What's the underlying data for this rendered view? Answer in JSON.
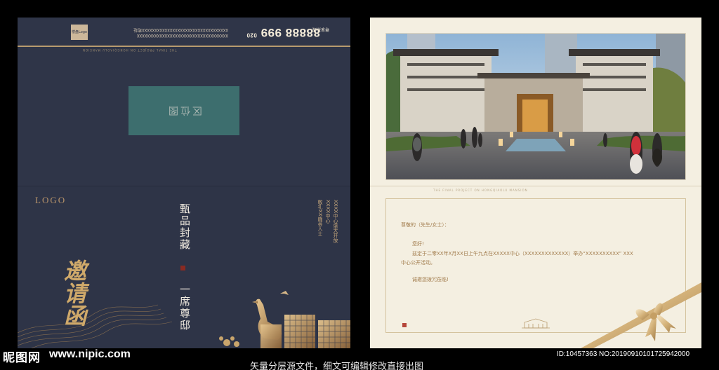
{
  "left_card": {
    "top_logo": "楼盘Logo",
    "top_xx_line1": "XXXXXXXXXXXXXXXXXXXXXXXXXXXXXXXXXXXX",
    "top_xx_line2": "XXXXXXXXXXXXXXXXXXXXXXXXXXXXXXXXXX地址",
    "phone": "88888 999",
    "phone_prefix": "020",
    "hotline_label": "尊享热线",
    "tagline": "THE FINAL PROJECT ON HONGQIAOLU MANSION",
    "placeholder": "区位图",
    "logo": "LOGO",
    "slogan_1": "甄品封藏",
    "slogan_2": "一席尊邸",
    "invite_title": "邀请函",
    "vert_col_1": "XXXX中心盛大开放",
    "vert_col_2": "XXXX中心",
    "vert_col_3": "敬礼XX峰荟人士"
  },
  "right_card": {
    "tagline": "THE FINAL PROJECT ON HONGQIAOLU MANSION",
    "salutation": "尊敬的（先生/女士）：",
    "greeting": "您好!",
    "body_line1": "兹定于二零XX年X月XX日上午九点在XXXXX中心（XXXXXXXXXXXXX）举办“XXXXXXXXXX” XXX",
    "body_line2": "中心公开活动。",
    "closing": "诚邀您拨冗莅临!"
  },
  "watermark": {
    "site_name": "昵图网",
    "site_url": "www.nipic.com",
    "caption": "矢量分层源文件，细文可编辑修改直接出图",
    "image_id": "ID:10457363 NO:20190910101725942000"
  },
  "colors": {
    "navy": "#2e3447",
    "gold": "#c9a56c",
    "teal": "#3d6e6e",
    "cream": "#f4efe1"
  }
}
